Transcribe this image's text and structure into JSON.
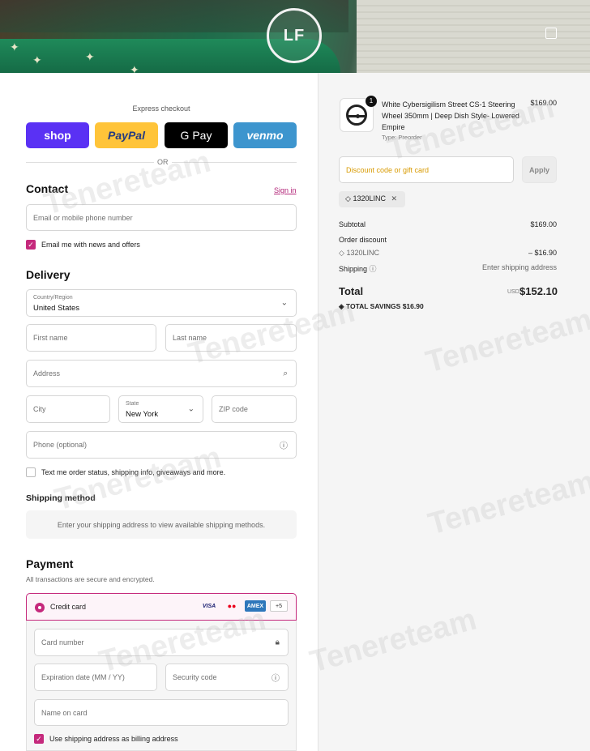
{
  "hero": {
    "logo_text": "LF"
  },
  "express": {
    "title": "Express checkout",
    "shop": "shop",
    "paypal": "PayPal",
    "gpay": "G Pay",
    "venmo": "venmo",
    "or": "OR"
  },
  "contact": {
    "heading": "Contact",
    "sign_in": "Sign in",
    "email_placeholder": "Email or mobile phone number",
    "news_label": "Email me with news and offers"
  },
  "delivery": {
    "heading": "Delivery",
    "country_label": "Country/Region",
    "country_value": "United States",
    "first_name": "First name",
    "last_name": "Last name",
    "address": "Address",
    "city": "City",
    "state_label": "State",
    "state_value": "New York",
    "zip": "ZIP code",
    "phone": "Phone (optional)",
    "sms_label": "Text me order status, shipping info, giveaways and more."
  },
  "shipping": {
    "heading": "Shipping method",
    "message": "Enter your shipping address to view available shipping methods."
  },
  "payment": {
    "heading": "Payment",
    "subtext": "All transactions are secure and encrypted.",
    "method_label": "Credit card",
    "cards": [
      "VISA",
      "●●",
      "AMEX",
      "+5"
    ],
    "card_number": "Card number",
    "expiration": "Expiration date (MM / YY)",
    "security_code": "Security code",
    "name_on_card": "Name on card",
    "billing_label": "Use shipping address as billing address"
  },
  "order": {
    "qty": "1",
    "title": "White Cybersigilism Street CS-1 Steering Wheel 350mm | Deep Dish Style- Lowered Empire",
    "type": "Type: Preorder",
    "price": "$169.00",
    "discount_placeholder": "Discount code or gift card",
    "apply": "Apply",
    "code_chip": "1320LINC",
    "subtotal_label": "Subtotal",
    "subtotal_value": "$169.00",
    "order_discount_label": "Order discount",
    "discount_code": "1320LINC",
    "discount_value": "– $16.90",
    "shipping_label": "Shipping",
    "shipping_value": "Enter shipping address",
    "total_label": "Total",
    "currency": "USD",
    "total_value": "$152.10",
    "savings_label": "TOTAL SAVINGS",
    "savings_value": "$16.90"
  },
  "watermark": "Tenereteam",
  "colors": {
    "accent": "#c5297c",
    "shop_pay": "#5a31f4",
    "paypal": "#ffc439",
    "venmo": "#3d95ce"
  }
}
